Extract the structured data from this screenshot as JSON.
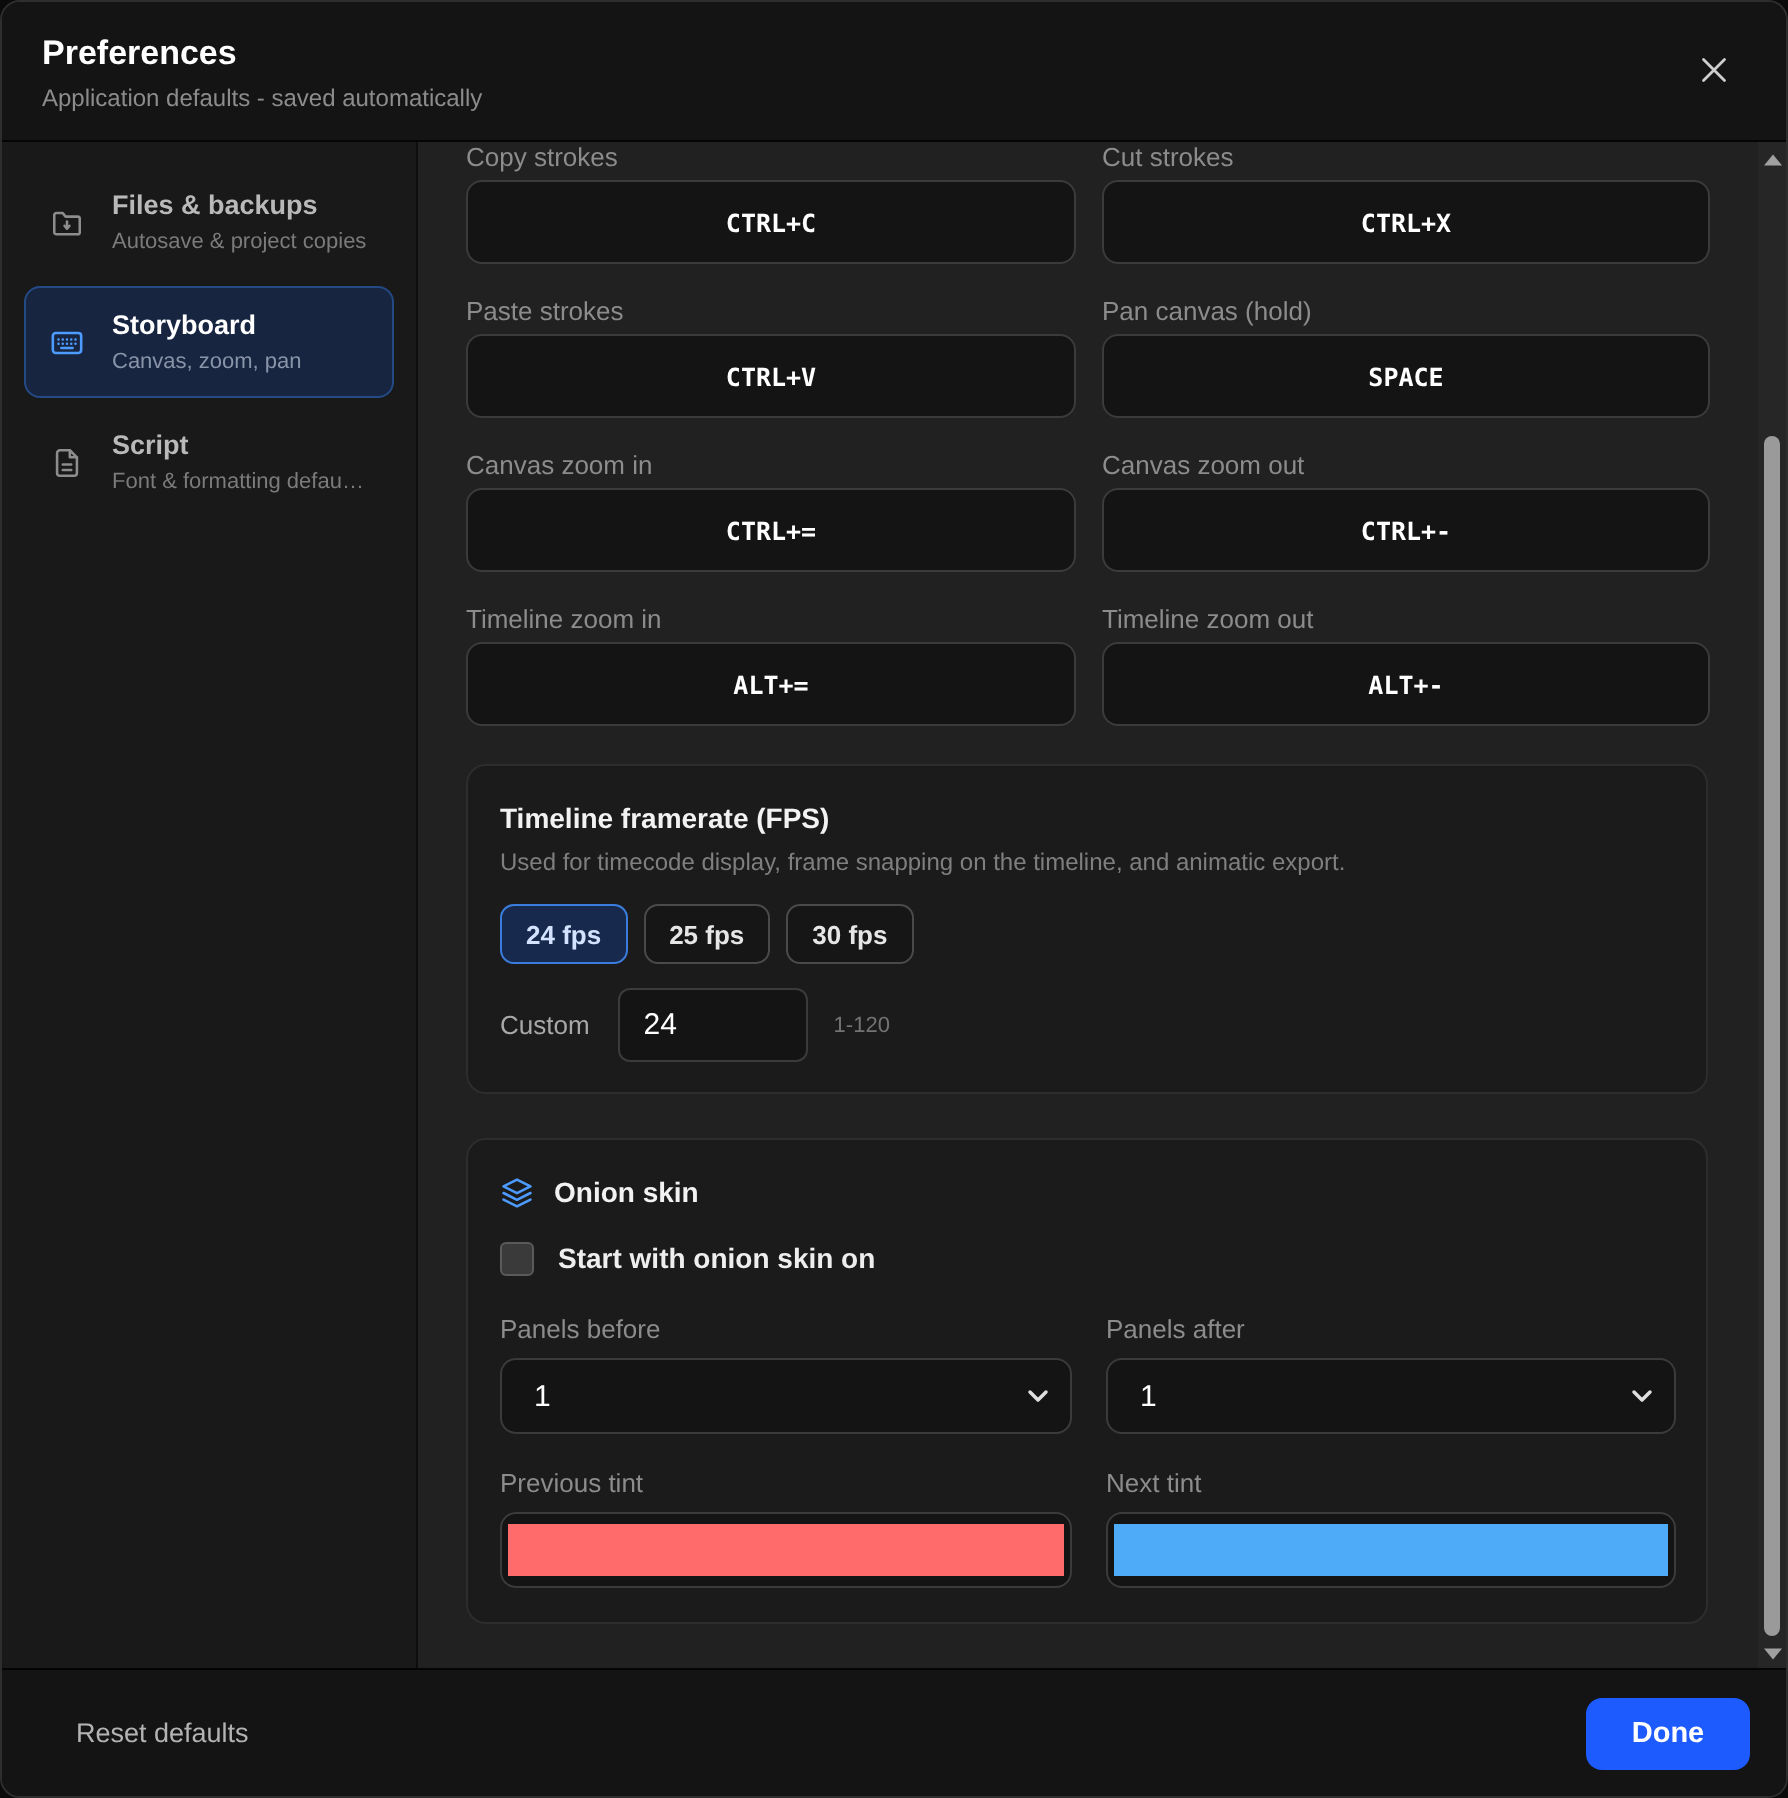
{
  "window": {
    "title": "Preferences",
    "subtitle": "Application defaults - saved automatically"
  },
  "sidebar": {
    "items": [
      {
        "kind": "folder",
        "title": "Files & backups",
        "subtitle": "Autosave & project copies",
        "selected": false
      },
      {
        "kind": "keyboard",
        "title": "Storyboard",
        "subtitle": "Canvas, zoom, pan",
        "selected": true
      },
      {
        "kind": "document",
        "title": "Script",
        "subtitle": "Font & formatting defau…",
        "selected": false
      }
    ]
  },
  "shortcuts": [
    {
      "label": "Copy strokes",
      "keys": "CTRL+C"
    },
    {
      "label": "Cut strokes",
      "keys": "CTRL+X"
    },
    {
      "label": "Paste strokes",
      "keys": "CTRL+V"
    },
    {
      "label": "Pan canvas (hold)",
      "keys": "SPACE"
    },
    {
      "label": "Canvas zoom in",
      "keys": "CTRL+="
    },
    {
      "label": "Canvas zoom out",
      "keys": "CTRL+-"
    },
    {
      "label": "Timeline zoom in",
      "keys": "ALT+="
    },
    {
      "label": "Timeline zoom out",
      "keys": "ALT+-"
    }
  ],
  "framerate": {
    "title": "Timeline framerate (FPS)",
    "description": "Used for timecode display, frame snapping on the timeline, and animatic export.",
    "options": [
      {
        "label": "24 fps",
        "selected": true
      },
      {
        "label": "25 fps",
        "selected": false
      },
      {
        "label": "30 fps",
        "selected": false
      }
    ],
    "custom": {
      "label": "Custom",
      "value": "24",
      "hint": "1-120"
    }
  },
  "onion_skin": {
    "title": "Onion skin",
    "start_option": {
      "label": "Start with onion skin on",
      "checked": false
    },
    "panel_counts": [
      {
        "label": "Panels before",
        "value": "1"
      },
      {
        "label": "Panels after",
        "value": "1"
      }
    ],
    "tints": [
      {
        "label": "Previous tint",
        "color": "#ff6b6b"
      },
      {
        "label": "Next tint",
        "color": "#4dabf7"
      }
    ]
  },
  "footer": {
    "reset": "Reset defaults",
    "done": "Done"
  }
}
